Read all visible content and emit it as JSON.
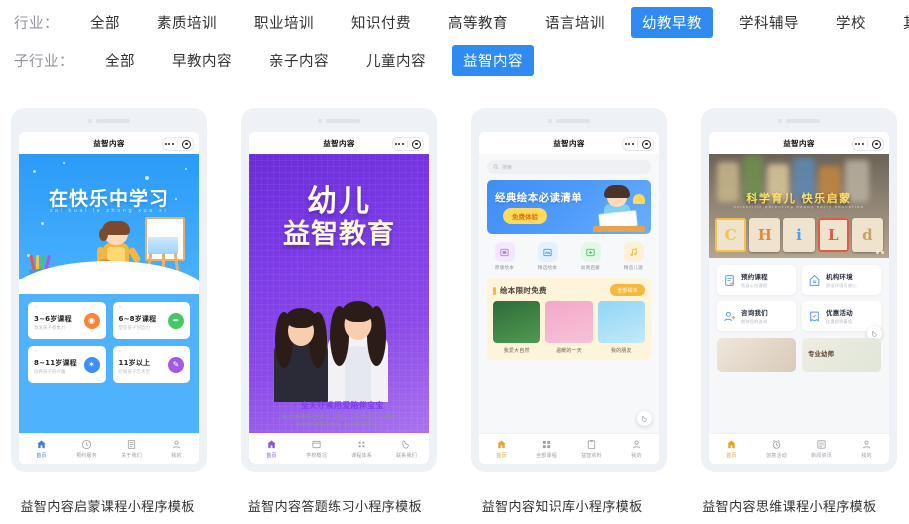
{
  "filters": [
    {
      "label": "行业：",
      "name": "industry",
      "items": [
        {
          "text": "全部",
          "active": false
        },
        {
          "text": "素质培训",
          "active": false
        },
        {
          "text": "职业培训",
          "active": false
        },
        {
          "text": "知识付费",
          "active": false
        },
        {
          "text": "高等教育",
          "active": false
        },
        {
          "text": "语言培训",
          "active": false
        },
        {
          "text": "幼教早教",
          "active": true
        },
        {
          "text": "学科辅导",
          "active": false
        },
        {
          "text": "学校",
          "active": false
        },
        {
          "text": "其他",
          "active": false
        }
      ]
    },
    {
      "label": "子行业：",
      "name": "sub-industry",
      "items": [
        {
          "text": "全部",
          "active": false
        },
        {
          "text": "早教内容",
          "active": false
        },
        {
          "text": "亲子内容",
          "active": false
        },
        {
          "text": "儿童内容",
          "active": false
        },
        {
          "text": "益智内容",
          "active": true
        }
      ]
    }
  ],
  "colors": {
    "accent": "#2f8bf2",
    "page_bg": "#ffffff",
    "phone_frame": "#eef1f5",
    "card1_blue": "#4fb2fc",
    "card2_purple": "#7b3ae6",
    "card3_yellow": "#f6b93b",
    "card4_orange": "#f0a020"
  },
  "cards": [
    {
      "caption": "益智内容启蒙课程小程序模板",
      "nav_title": "益智内容",
      "hero_title": "在快乐中学习",
      "hero_pinyin": "zai kuai le zhong xue xi",
      "courses": [
        {
          "title": "3~6岁课程",
          "subtitle": "激发孩子想象力",
          "icon": "palette-icon",
          "color": "#f6873a"
        },
        {
          "title": "6~8岁课程",
          "subtitle": "塑造孩子创造力",
          "icon": "brush-icon",
          "color": "#45c767"
        },
        {
          "title": "8~11岁课程",
          "subtitle": "培养孩子的兴趣",
          "icon": "star-icon",
          "color": "#3f8ef7"
        },
        {
          "title": "11岁以上",
          "subtitle": "挖掘孩子艺术型",
          "icon": "pencil-icon",
          "color": "#a259e6"
        }
      ],
      "tabs": [
        {
          "label": "首页",
          "icon": "home-icon",
          "active": true
        },
        {
          "label": "预约服务",
          "icon": "clock-icon",
          "active": false
        },
        {
          "label": "关于我们",
          "icon": "doc-icon",
          "active": false
        },
        {
          "label": "我的",
          "icon": "user-icon",
          "active": false
        }
      ]
    },
    {
      "caption": "益智内容答题练习小程序模板",
      "nav_title": "益智内容",
      "hero_line1": "幼儿",
      "hero_line2": "益智教育",
      "headline": "· 全天守候用爱陪伴宝宝",
      "desc_line1": "独创以培养孩子生存力、学习力、幸福力的三力培育体",
      "desc_line2": "系令家教育孩子灵敏，多元培养孩子能力",
      "tabs": [
        {
          "label": "首页",
          "icon": "home-icon",
          "active": true
        },
        {
          "label": "学校概况",
          "icon": "book-icon",
          "active": false
        },
        {
          "label": "课程体系",
          "icon": "grid-icon",
          "active": false
        },
        {
          "label": "联系我们",
          "icon": "phone-icon",
          "active": false
        }
      ]
    },
    {
      "caption": "益智内容知识库小程序模板",
      "nav_title": "益智内容",
      "search_placeholder": "搜索",
      "banner_title": "经典绘本必读清单",
      "banner_button": "免费体验",
      "quick_icons": [
        {
          "label": "原版绘本",
          "icon": "book-cover-icon",
          "bg": "#f3e8ff",
          "fg": "#b07ef0"
        },
        {
          "label": "精选绘本",
          "icon": "picture-book-icon",
          "bg": "#e3f0ff",
          "fg": "#4e9bfa"
        },
        {
          "label": "幼教启蒙",
          "icon": "download-icon",
          "bg": "#e4f8e8",
          "fg": "#45c767"
        },
        {
          "label": "精品儿歌",
          "icon": "music-icon",
          "bg": "#fdf0d6",
          "fg": "#f6b93b"
        }
      ],
      "free_section_title": "绘本限时免费",
      "free_section_button": "全部绘本",
      "books": [
        {
          "name": "我爱大自然",
          "c1": "#2f6b3a",
          "c2": "#4f9a52"
        },
        {
          "name": "温暖的一天",
          "c1": "#f3a8c8",
          "c2": "#f7c2d8"
        },
        {
          "name": "我的朋友",
          "c1": "#8fd6f5",
          "c2": "#c3e9fb"
        }
      ],
      "tabs": [
        {
          "label": "首页",
          "icon": "home-icon",
          "active": true
        },
        {
          "label": "全部课程",
          "icon": "grid-icon",
          "active": false
        },
        {
          "label": "益智资料",
          "icon": "clipboard-icon",
          "active": false
        },
        {
          "label": "我的",
          "icon": "user-icon",
          "active": false
        }
      ]
    },
    {
      "caption": "益智内容思维课程小程序模板",
      "nav_title": "益智内容",
      "hero_title": "科学育儿 快乐启蒙",
      "hero_subtitle": "scientific parenting happy early education",
      "blocks": [
        {
          "letter": "C",
          "color": "#f2c24a"
        },
        {
          "letter": "H",
          "color": "#e08a3c"
        },
        {
          "letter": "i",
          "color": "#4e9bfa"
        },
        {
          "letter": "L",
          "color": "#e05a4a"
        },
        {
          "letter": "d",
          "color": "#c9a06a"
        }
      ],
      "menu": [
        {
          "title": "预约课程",
          "subtitle": "您身心仪课程",
          "icon": "form-icon"
        },
        {
          "title": "机构环境",
          "subtitle": "舒适环境可放心",
          "icon": "house-icon"
        },
        {
          "title": "咨询我们",
          "subtitle": "期待您的咨询",
          "icon": "service-icon"
        },
        {
          "title": "优惠活动",
          "subtitle": "优惠即等着您",
          "icon": "coupon-icon"
        }
      ],
      "photo_label": "专业幼师",
      "tabs": [
        {
          "label": "首页",
          "icon": "home-icon",
          "active": true
        },
        {
          "label": "创意活动",
          "icon": "alarm-icon",
          "active": false
        },
        {
          "label": "新闻资讯",
          "icon": "news-icon",
          "active": false
        },
        {
          "label": "我的",
          "icon": "user-icon",
          "active": false
        }
      ]
    }
  ]
}
